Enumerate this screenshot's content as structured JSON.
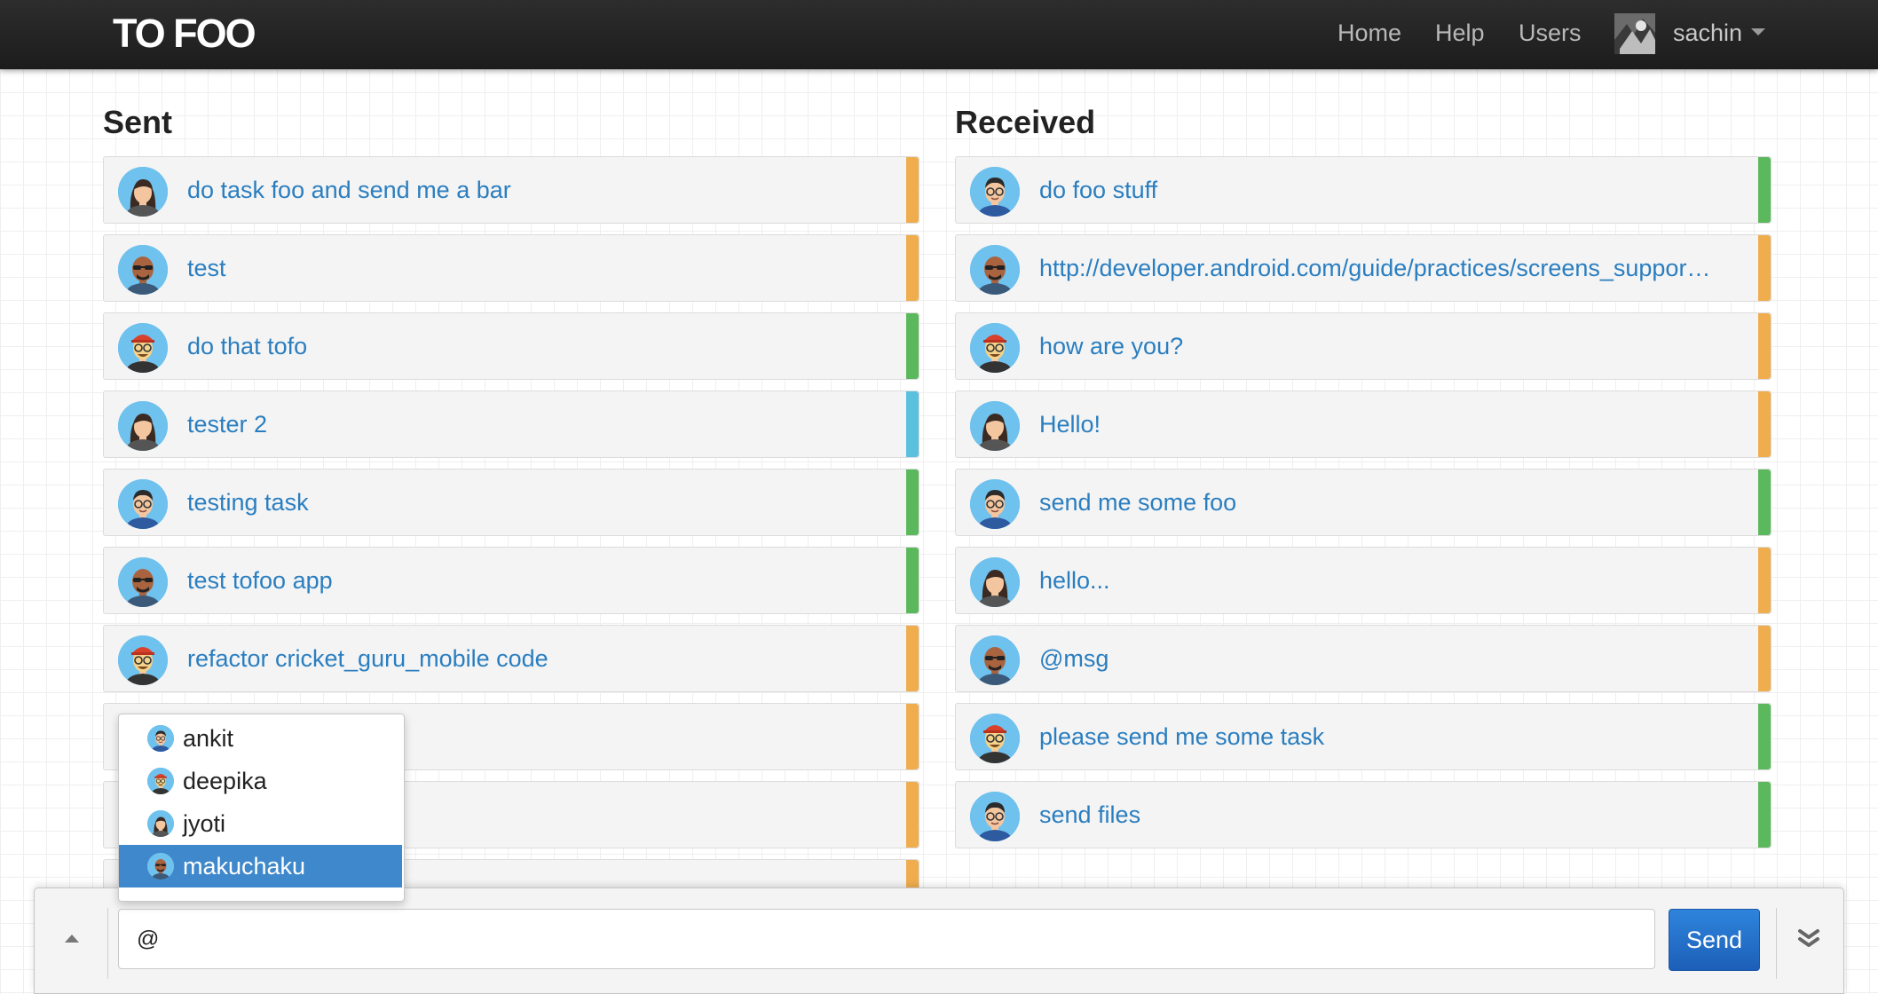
{
  "app": {
    "brand": "TO FOO"
  },
  "nav": {
    "home": "Home",
    "help": "Help",
    "users": "Users",
    "username": "sachin"
  },
  "sent": {
    "title": "Sent",
    "items": [
      {
        "text": "do task foo and send me a bar",
        "avatar": "woman",
        "status_color": "#f0ad4e"
      },
      {
        "text": "test",
        "avatar": "bald-shades",
        "status_color": "#f0ad4e"
      },
      {
        "text": "do that tofo",
        "avatar": "redcap-glasses",
        "status_color": "#5cb85c"
      },
      {
        "text": "tester 2",
        "avatar": "woman",
        "status_color": "#5bc0de"
      },
      {
        "text": "testing task",
        "avatar": "man-glasses",
        "status_color": "#5cb85c"
      },
      {
        "text": "test tofoo app",
        "avatar": "bald-shades",
        "status_color": "#5cb85c"
      },
      {
        "text": "refactor cricket_guru_mobile code",
        "avatar": "redcap-glasses",
        "status_color": "#f0ad4e"
      },
      {
        "text": "",
        "avatar": "",
        "status_color": "#f0ad4e"
      },
      {
        "text": "",
        "avatar": "",
        "status_color": "#f0ad4e"
      },
      {
        "text": "",
        "avatar": "",
        "status_color": "#f0ad4e"
      }
    ]
  },
  "received": {
    "title": "Received",
    "items": [
      {
        "text": "do foo stuff",
        "avatar": "man-glasses",
        "status_color": "#5cb85c"
      },
      {
        "text": "http://developer.android.com/guide/practices/screens_suppor…",
        "avatar": "bald-shades",
        "status_color": "#f0ad4e"
      },
      {
        "text": "how are you?",
        "avatar": "redcap-glasses",
        "status_color": "#f0ad4e"
      },
      {
        "text": "Hello!",
        "avatar": "woman",
        "status_color": "#f0ad4e"
      },
      {
        "text": "send me some foo",
        "avatar": "man-glasses",
        "status_color": "#5cb85c"
      },
      {
        "text": "hello...",
        "avatar": "woman",
        "status_color": "#f0ad4e"
      },
      {
        "text": "@msg",
        "avatar": "bald-shades",
        "status_color": "#f0ad4e"
      },
      {
        "text": "please send me some task",
        "avatar": "redcap-glasses",
        "status_color": "#5cb85c"
      },
      {
        "text": "send files",
        "avatar": "man-glasses",
        "status_color": "#5cb85c"
      }
    ]
  },
  "mention_dropdown": {
    "options": [
      {
        "name": "ankit",
        "avatar": "man-glasses"
      },
      {
        "name": "deepika",
        "avatar": "redcap-glasses"
      },
      {
        "name": "jyoti",
        "avatar": "woman"
      },
      {
        "name": "makuchaku",
        "avatar": "bald-shades",
        "selected": true
      }
    ]
  },
  "composer": {
    "input_value": "@",
    "send_label": "Send"
  },
  "icons": {
    "expand": "caret-up-icon",
    "collapse": "double-chevron-down-icon",
    "user_menu": "caret-down-icon"
  }
}
